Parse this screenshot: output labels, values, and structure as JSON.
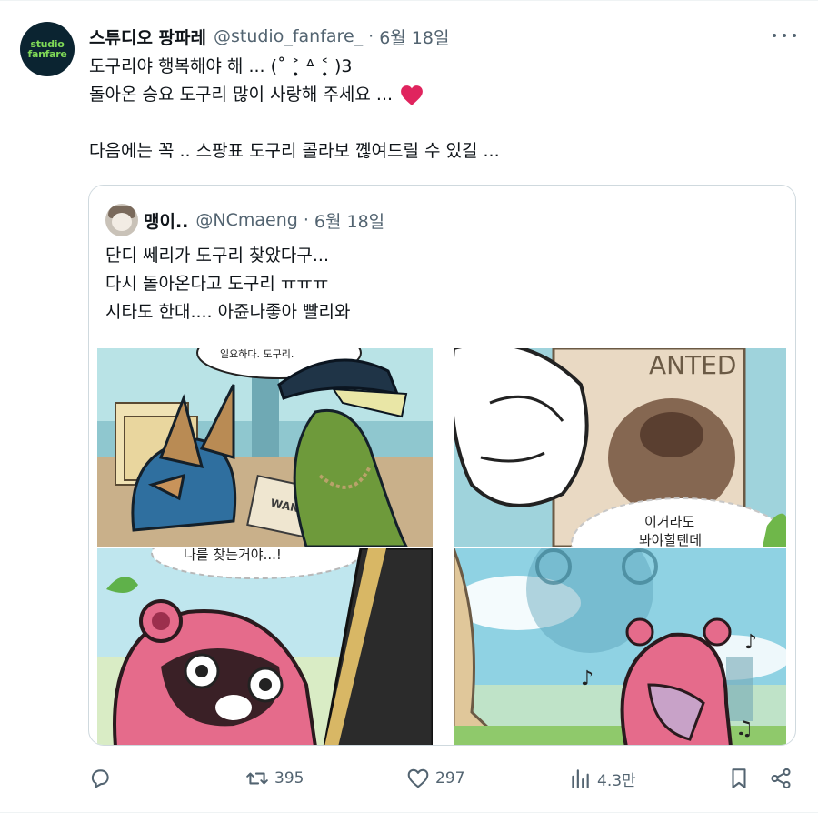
{
  "tweet": {
    "avatar_text_line1": "studio",
    "avatar_text_line2": "fanfare",
    "display_name": "스튜디오 팡파레",
    "handle": "@studio_fanfare_",
    "separator": "·",
    "time": "6월 18일",
    "text_lines": [
      "도구리야 행복해야 해 ... (˚ ˃̣̣̥ ᐞ ˂̣̣̥ )3",
      "돌아온 승요 도구리 많이 사랑해 주세요 ...",
      "",
      "다음에는 꼭 .. 스팡표 도구리 콜라보 꼖여드릴 수 있길 ..."
    ],
    "heart_emoji_color": "#e0245e"
  },
  "quote": {
    "display_name": "맹이..",
    "handle": "@NCmaeng",
    "separator": "·",
    "time": "6월 18일",
    "text_lines": [
      "단디 쎄리가 도구리 찾았다구...",
      "다시 돌아온다고 도구리 ㅠㅠㅠ",
      "시타도 한대.... 아쥰나좋아 빨리와"
    ],
    "media": {
      "panel1_speech": "일요하다. 도구리.",
      "panel1_sign": "WANTED",
      "panel2_sign": "ANTED",
      "panel2_speech_line1": "이거라도",
      "panel2_speech_line2": "봐야할텐데",
      "panel3_speech": "나를 찾는거야...!"
    }
  },
  "actions": {
    "reply_count": "",
    "retweet_count": "395",
    "like_count": "297",
    "views_count": "4.3만"
  },
  "colors": {
    "text_primary": "#0f1419",
    "text_secondary": "#536471",
    "border": "#cfd9de",
    "brand_green": "#7fd957",
    "avatar_bg": "#0b2431"
  }
}
